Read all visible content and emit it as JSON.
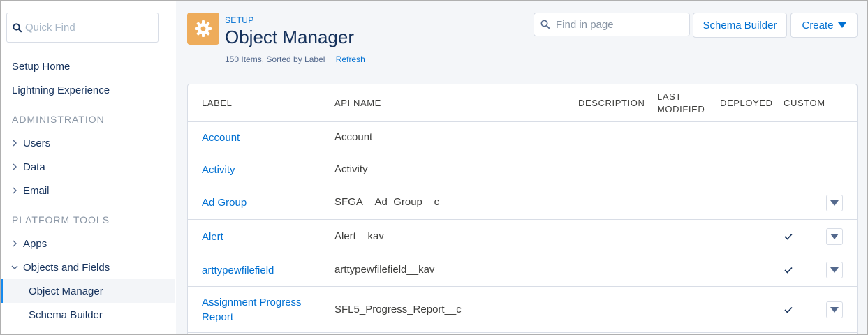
{
  "sidebar": {
    "quick_find_placeholder": "Quick Find",
    "links": [
      "Setup Home",
      "Lightning Experience"
    ],
    "section_admin": "ADMINISTRATION",
    "admin_items": [
      "Users",
      "Data",
      "Email"
    ],
    "section_platform": "PLATFORM TOOLS",
    "platform_items": [
      "Apps",
      "Objects and Fields"
    ],
    "sub_items": [
      "Object Manager",
      "Schema Builder"
    ],
    "active_sub_item": "Object Manager"
  },
  "header": {
    "eyebrow": "SETUP",
    "title": "Object Manager",
    "meta_text": "150 Items, Sorted by Label",
    "refresh_label": "Refresh",
    "find_placeholder": "Find in page",
    "schema_builder_label": "Schema Builder",
    "create_label": "Create"
  },
  "table": {
    "columns": {
      "label": "LABEL",
      "api_name": "API NAME",
      "description": "DESCRIPTION",
      "last_modified_1": "LAST",
      "last_modified_2": "MODIFIED",
      "deployed": "DEPLOYED",
      "custom": "CUSTOM"
    },
    "rows": [
      {
        "label": "Account",
        "label2": "",
        "api_name": "Account",
        "custom": false,
        "menu": false
      },
      {
        "label": "Activity",
        "label2": "",
        "api_name": "Activity",
        "custom": false,
        "menu": false
      },
      {
        "label": "Ad Group",
        "label2": "",
        "api_name": "SFGA__Ad_Group__c",
        "custom": false,
        "menu": true
      },
      {
        "label": "Alert",
        "label2": "",
        "api_name": "Alert__kav",
        "custom": true,
        "menu": true
      },
      {
        "label": "arttypewfilefield",
        "label2": "",
        "api_name": "arttypewfilefield__kav",
        "custom": true,
        "menu": true
      },
      {
        "label": "Assignment Progress",
        "label2": "Report",
        "api_name": "SFL5_Progress_Report__c",
        "custom": true,
        "menu": true
      }
    ]
  },
  "colors": {
    "accent": "#0070d2",
    "setup_icon_bg": "#eeac5b",
    "active_indicator": "#1589ee"
  },
  "icons": {
    "search": "search-icon",
    "gear": "gear-icon",
    "chevron_right": "chevron-right-icon",
    "chevron_down": "chevron-down-icon",
    "caret_down": "caret-down-icon",
    "check": "check-icon"
  }
}
